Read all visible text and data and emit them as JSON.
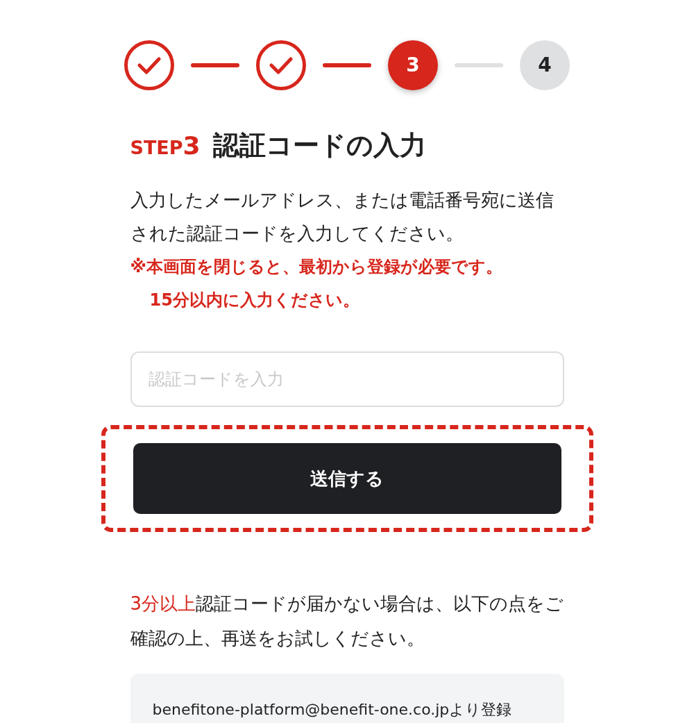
{
  "steps": [
    {
      "completed": true,
      "selected": false
    },
    {
      "completed": true,
      "selected": false
    },
    {
      "completed": false,
      "selected": true,
      "label": "3"
    },
    {
      "completed": false,
      "selected": false,
      "label": "4"
    }
  ],
  "heading": {
    "step_word": "STEP",
    "step_number": "3",
    "title": "認証コードの入力"
  },
  "instructions": "入力したメールアドレス、または電話番号宛に送信された認証コードを入力してください。",
  "warnings": [
    "※本画面を閉じると、最初から登録が必要です。",
    "15分以内に入力ください。"
  ],
  "code_field": {
    "placeholder": "認証コードを入力"
  },
  "submit_button": {
    "label": "送信する",
    "highlighted": true
  },
  "resend_note": {
    "highlight": "3分以上",
    "text": "認証コードが届かない場合は、以下の点をご確認の上、再送をお試しください。"
  },
  "info_box": {
    "lines": [
      "benefitone-platform@benefit-one.co.jpより登録"
    ]
  }
}
